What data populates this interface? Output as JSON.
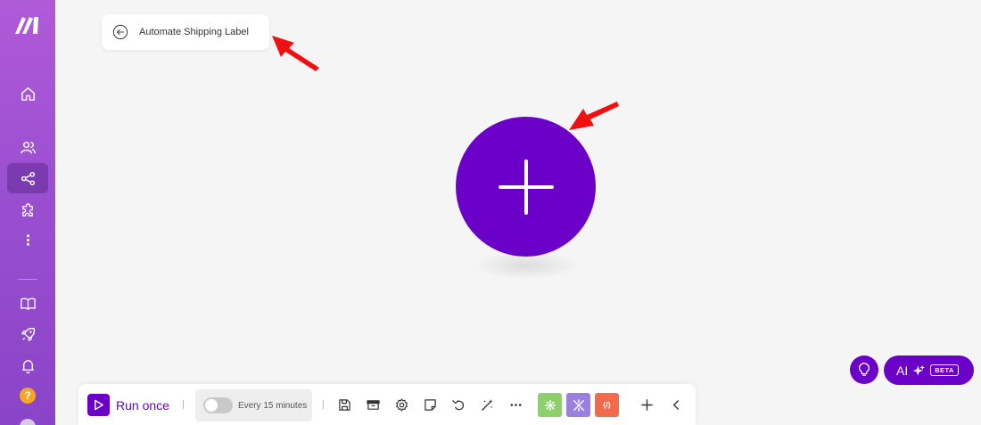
{
  "scenario": {
    "title": "Automate Shipping Label"
  },
  "toolbar": {
    "run_label": "Run once",
    "schedule_label": "Every 15 minutes",
    "json_btn_label": "{/}"
  },
  "assistant": {
    "ai_label": "AI",
    "beta_label": "BETA"
  },
  "sidebar": {
    "items": [
      "home-icon",
      "team-icon",
      "scenarios-icon",
      "apps-icon",
      "more-icon",
      "docs-icon",
      "launch-icon",
      "notifications-icon",
      "help-icon"
    ],
    "help_label": "?"
  },
  "colors": {
    "accent": "#6b00c9",
    "sidebar_top": "#b05ad8",
    "green_btn": "#8dcf6a",
    "purple_btn": "#9b7fe0",
    "orange_btn": "#f26b4c",
    "annotation_arrow": "#f01010"
  }
}
